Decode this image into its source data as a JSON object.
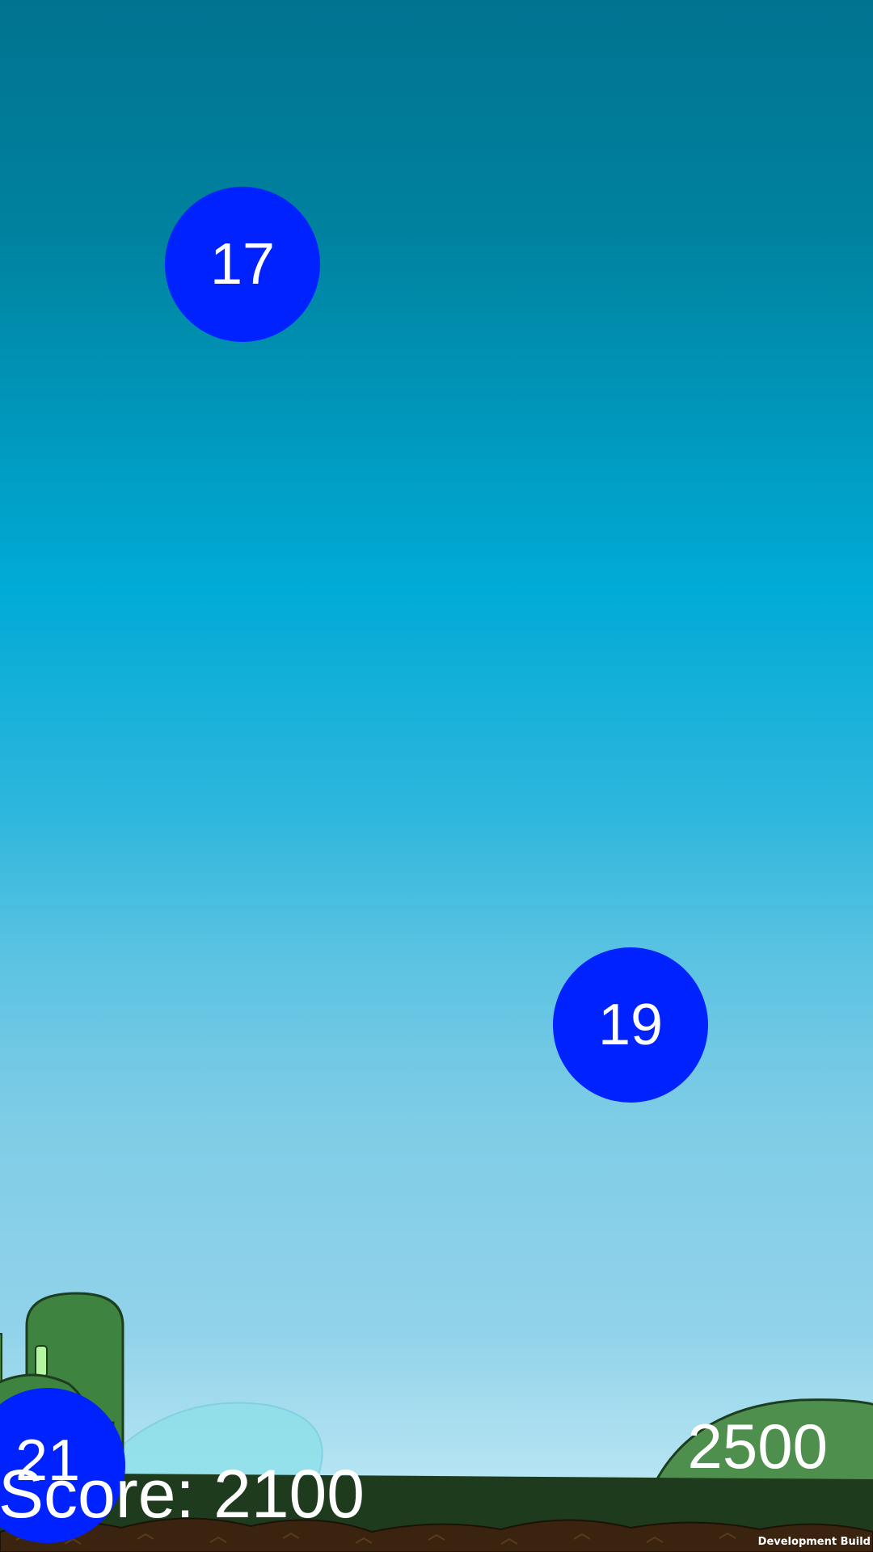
{
  "game": {
    "bubbles": [
      {
        "number": "17",
        "color": "#0022ff"
      },
      {
        "number": "19",
        "color": "#0022ff"
      },
      {
        "number": "21",
        "color": "#0022ff"
      }
    ],
    "score_text": "Score: 2100",
    "target_score": "2500"
  },
  "footer": {
    "build_label": "Development Build"
  },
  "colors": {
    "sky_top": "#007390",
    "sky_bottom": "#b9e6f3",
    "bubble": "#0022ff",
    "hill_green": "#3e8340",
    "ground_dark": "#1f3b1e",
    "dirt": "#3a2410"
  }
}
